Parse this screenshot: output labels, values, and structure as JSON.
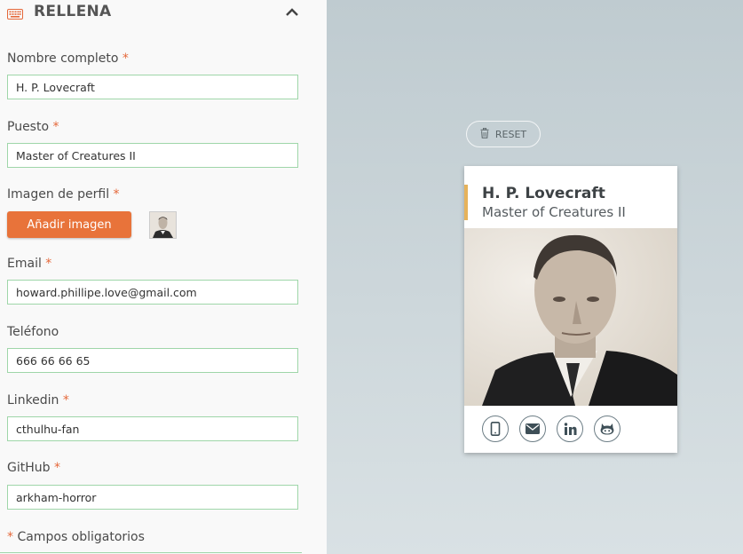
{
  "panel": {
    "title": "RELLENA"
  },
  "form": {
    "required_mark": "*",
    "full_name": {
      "label": "Nombre completo",
      "value": "H. P. Lovecraft"
    },
    "position": {
      "label": "Puesto",
      "value": "Master of Creatures II"
    },
    "profile_image": {
      "label": "Imagen de perfil",
      "button_label": "Añadir imagen"
    },
    "email": {
      "label": "Email",
      "value": "howard.phillipe.love@gmail.com"
    },
    "phone": {
      "label": "Teléfono",
      "value": "666 66 66 65"
    },
    "linkedin": {
      "label": "Linkedin",
      "value": "cthulhu-fan"
    },
    "github": {
      "label": "GitHub",
      "value": "arkham-horror"
    },
    "required_note": "Campos obligatorios"
  },
  "preview": {
    "reset_label": "RESET",
    "card": {
      "name": "H. P. Lovecraft",
      "role": "Master of Creatures II"
    },
    "icons": [
      "phone-icon",
      "email-icon",
      "linkedin-icon",
      "github-icon"
    ]
  },
  "colors": {
    "accent": "#e8733a",
    "field_border": "#9fd6a9",
    "card_accent": "#e6b25a"
  }
}
